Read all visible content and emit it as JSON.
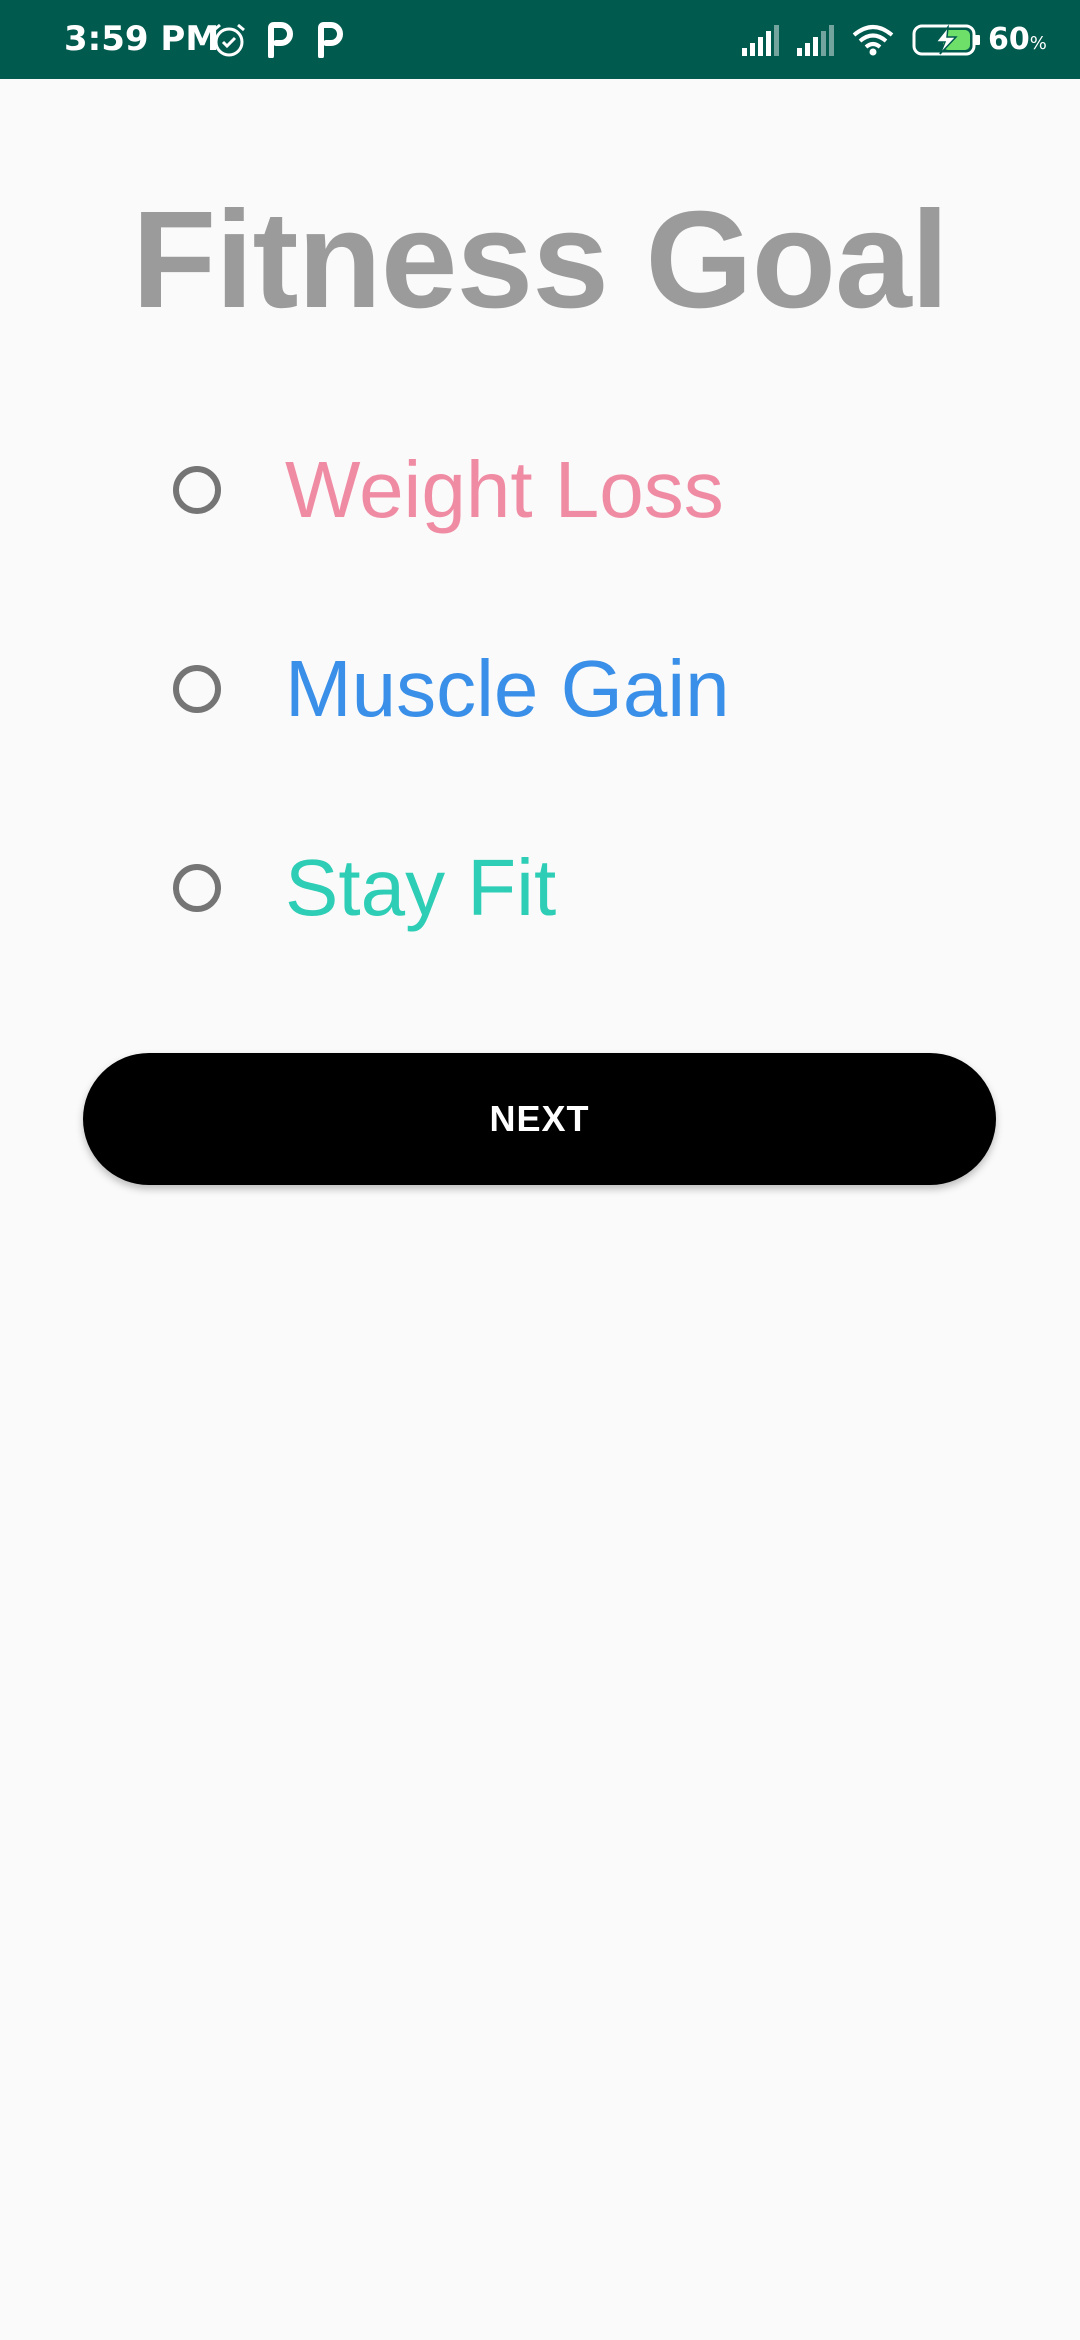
{
  "status_bar": {
    "time": "3:59 PM",
    "battery_percent": "60",
    "battery_unit": "%",
    "background": "#005a4e",
    "icons": [
      "alarm-icon",
      "parking-icon",
      "parking-icon",
      "signal-icon",
      "signal-icon",
      "wifi-icon",
      "battery-charging-icon"
    ]
  },
  "page": {
    "title": "Fitness Goal",
    "title_color": "#9b9b9b"
  },
  "options": [
    {
      "label": "Weight Loss",
      "color": "#f08ba4",
      "selected": false
    },
    {
      "label": "Muscle Gain",
      "color": "#3a8fe8",
      "selected": false
    },
    {
      "label": "Stay Fit",
      "color": "#2ecdb5",
      "selected": false
    }
  ],
  "next_button": {
    "label": "NEXT",
    "background": "#000000",
    "text_color": "#ffffff"
  }
}
